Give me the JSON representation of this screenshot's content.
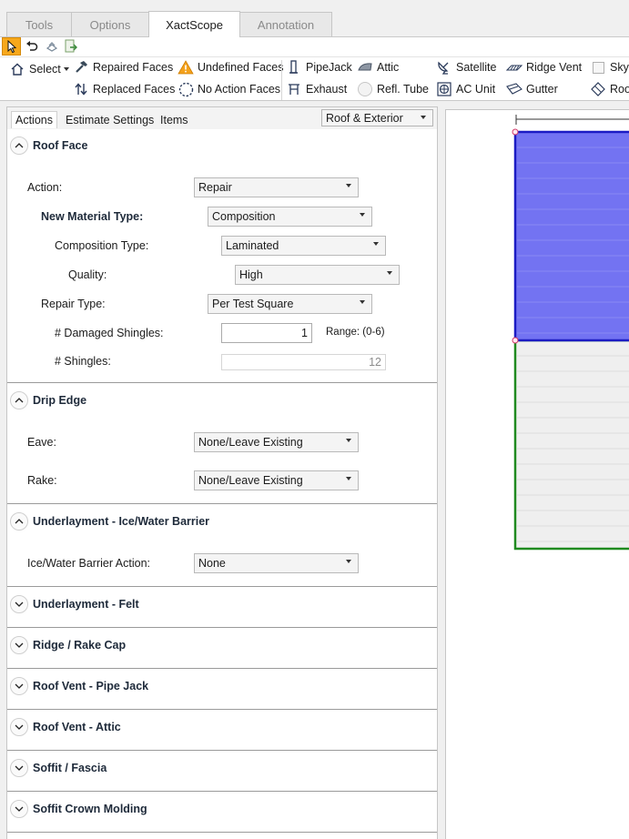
{
  "tabs": [
    {
      "label": "Tools",
      "active": false
    },
    {
      "label": "Options",
      "active": false
    },
    {
      "label": "XactScope",
      "active": true
    },
    {
      "label": "Annotation",
      "active": false
    }
  ],
  "toolbar": {
    "select_label": "Select",
    "repaired_faces": "Repaired Faces",
    "replaced_faces": "Replaced Faces",
    "undefined_faces": "Undefined Faces",
    "no_action_faces": "No Action Faces",
    "pipejack": "PipeJack",
    "exhaust": "Exhaust",
    "attic": "Attic",
    "refl_tube": "Refl. Tube",
    "satellite": "Satellite",
    "ac_unit": "AC Unit",
    "ridge_vent": "Ridge Vent",
    "gutter": "Gutter",
    "skylight": "Skyl",
    "roof": "Roof"
  },
  "panel": {
    "subtabs": [
      "Actions",
      "Estimate Settings",
      "Items"
    ],
    "category": "Roof & Exterior"
  },
  "roof_face": {
    "title": "Roof Face",
    "action_label": "Action:",
    "action_value": "Repair",
    "material_label": "New Material Type:",
    "material_value": "Composition",
    "comp_type_label": "Composition Type:",
    "comp_type_value": "Laminated",
    "quality_label": "Quality:",
    "quality_value": "High",
    "repair_type_label": "Repair Type:",
    "repair_type_value": "Per Test Square",
    "damaged_label": "# Damaged Shingles:",
    "damaged_value": "1",
    "range_label": "Range: (0-6)",
    "shingles_label": "# Shingles:",
    "shingles_value": "12"
  },
  "drip_edge": {
    "title": "Drip Edge",
    "eave_label": "Eave:",
    "eave_value": "None/Leave Existing",
    "rake_label": "Rake:",
    "rake_value": "None/Leave Existing"
  },
  "ice_water": {
    "title": "Underlayment - Ice/Water Barrier",
    "action_label": "Ice/Water Barrier Action:",
    "action_value": "None"
  },
  "collapsed_sections": [
    "Underlayment - Felt",
    "Ridge / Rake Cap",
    "Roof Vent - Pipe Jack",
    "Roof Vent - Attic",
    "Soffit / Fascia",
    "Soffit Crown Molding"
  ],
  "colors": {
    "selected_face": "#7373f2",
    "selected_face_border": "#1c1cc4",
    "face_border": "#1f8a1f",
    "accent": "#f7a81b"
  }
}
